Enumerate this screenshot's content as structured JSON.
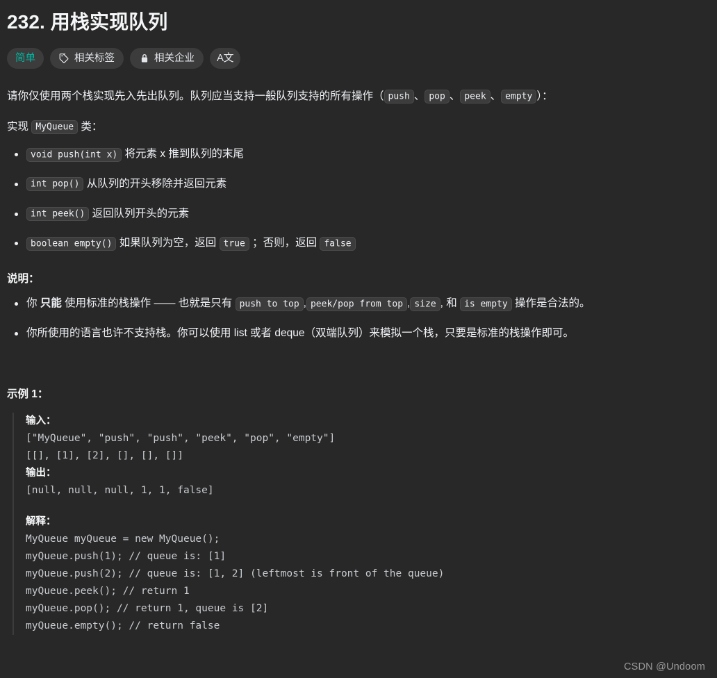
{
  "problem": {
    "title": "232. 用栈实现队列"
  },
  "badges": {
    "difficulty": "简单",
    "tags": "相关标签",
    "companies": "相关企业",
    "translate": "A文"
  },
  "description": {
    "line1_a": "请你仅使用两个栈实现先入先出队列。队列应当支持一般队列支持的所有操作（",
    "code_push": "push",
    "sep1": "、",
    "code_pop": "pop",
    "sep2": "、",
    "code_peek": "peek",
    "sep3": "、",
    "code_empty": "empty",
    "line1_b": "）：",
    "line2_a": "实现 ",
    "code_myqueue": "MyQueue",
    "line2_b": " 类："
  },
  "methods": [
    {
      "code": "void push(int x)",
      "text": "将元素 x 推到队列的末尾"
    },
    {
      "code": "int pop()",
      "text": "从队列的开头移除并返回元素"
    },
    {
      "code": "int peek()",
      "text": "返回队列开头的元素"
    }
  ],
  "method_empty": {
    "code": "boolean empty()",
    "text_a": "如果队列为空，返回 ",
    "code_true": "true",
    "text_b": " ；否则，返回 ",
    "code_false": "false"
  },
  "notes": {
    "heading": "说明：",
    "item1": {
      "a": "你 ",
      "bold": "只能",
      "b": " 使用标准的栈操作 —— 也就是只有 ",
      "code1": "push to top",
      "c": ",",
      "code2": "peek/pop from top",
      "d": ",",
      "code3": "size",
      "e": ", 和 ",
      "code4": "is empty",
      "f": " 操作是合法的。"
    },
    "item2": "你所使用的语言也许不支持栈。你可以使用 list 或者 deque（双端队列）来模拟一个栈，只要是标准的栈操作即可。"
  },
  "example": {
    "heading": "示例 1：",
    "input_label": "输入：",
    "input_lines": "[\"MyQueue\", \"push\", \"push\", \"peek\", \"pop\", \"empty\"]\n[[], [1], [2], [], [], []]",
    "output_label": "输出：",
    "output_lines": "[null, null, null, 1, 1, false]",
    "explain_label": "解释：",
    "explain_lines": "MyQueue myQueue = new MyQueue();\nmyQueue.push(1); // queue is: [1]\nmyQueue.push(2); // queue is: [1, 2] (leftmost is front of the queue)\nmyQueue.peek(); // return 1\nmyQueue.pop(); // return 1, queue is [2]\nmyQueue.empty(); // return false"
  },
  "watermark": "CSDN @Undoom"
}
